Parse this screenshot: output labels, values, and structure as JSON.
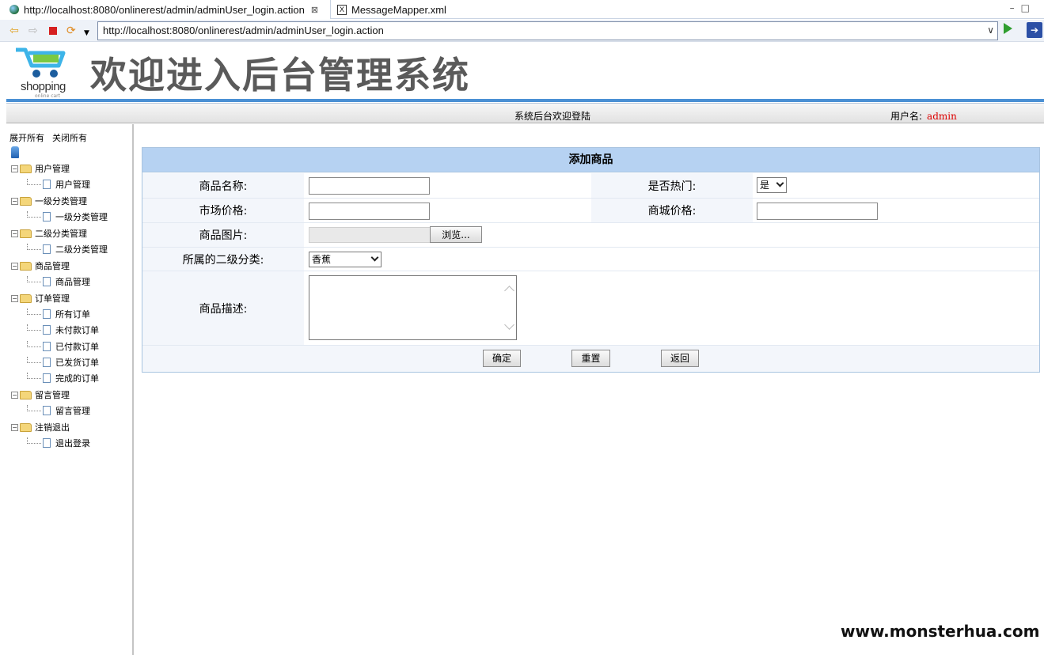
{
  "tabs": [
    {
      "label": "http://localhost:8080/onlinerest/admin/adminUser_login.action",
      "close": "⊠"
    },
    {
      "label": "MessageMapper.xml",
      "icon": "xml-file-icon"
    }
  ],
  "address": {
    "url": "http://localhost:8080/onlinerest/admin/adminUser_login.action"
  },
  "header": {
    "logo_text": "shopping",
    "logo_sub": "online cart",
    "title": "欢迎进入后台管理系统",
    "welcome": "系统后台欢迎登陆",
    "user_label": "用户名:",
    "user_name": "admin"
  },
  "tree": {
    "expand_all": "展开所有",
    "collapse_all": "关闭所有",
    "groups": [
      {
        "label": "用户管理",
        "children": [
          "用户管理"
        ]
      },
      {
        "label": "一级分类管理",
        "children": [
          "一级分类管理"
        ]
      },
      {
        "label": "二级分类管理",
        "children": [
          "二级分类管理"
        ]
      },
      {
        "label": "商品管理",
        "children": [
          "商品管理"
        ]
      },
      {
        "label": "订单管理",
        "children": [
          "所有订单",
          "未付款订单",
          "已付款订单",
          "已发货订单",
          "完成的订单"
        ]
      },
      {
        "label": "留言管理",
        "children": [
          "留言管理"
        ]
      },
      {
        "label": "注销退出",
        "children": [
          "退出登录"
        ]
      }
    ]
  },
  "form": {
    "title": "添加商品",
    "name_label": "商品名称:",
    "hot_label": "是否热门:",
    "hot_value": "是",
    "market_price_label": "市场价格:",
    "shop_price_label": "商城价格:",
    "image_label": "商品图片:",
    "browse_label": "浏览...",
    "category_label": "所属的二级分类:",
    "category_value": "香蕉",
    "desc_label": "商品描述:",
    "submit_label": "确定",
    "reset_label": "重置",
    "back_label": "返回"
  },
  "watermark": "www.monsterhua.com"
}
